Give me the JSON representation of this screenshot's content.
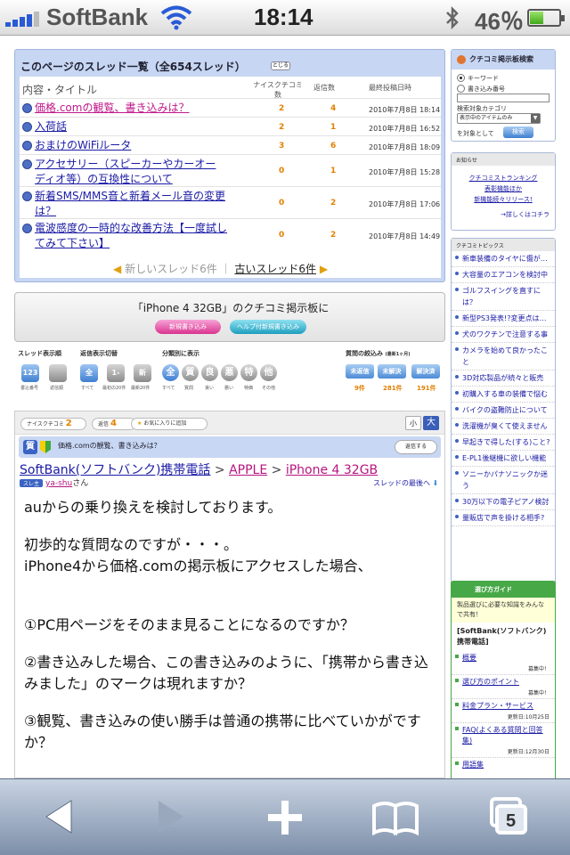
{
  "status": {
    "carrier": "SoftBank",
    "time": "18:14",
    "battery": "46％",
    "battery_level": 0.46
  },
  "thread_list": {
    "heading": "このページのスレッド一覧（全654スレッド）",
    "close_label": "とじる",
    "columns": {
      "title": "内容・タイトル",
      "nice": "ナイスクチコミ数",
      "replies": "返信数",
      "last": "最終投稿日時"
    },
    "rows": [
      {
        "title": "価格.comの観覧、書き込みは？",
        "nice": "2",
        "replies": "4",
        "date": "2010年7月8日 18:14",
        "current": true
      },
      {
        "title": "入荷話",
        "nice": "2",
        "replies": "1",
        "date": "2010年7月8日 16:52"
      },
      {
        "title": "おまけのWiFiルータ",
        "nice": "3",
        "replies": "6",
        "date": "2010年7月8日 18:09"
      },
      {
        "title_lines": [
          "アクセサリー（スピーカーやカーオー",
          "ディオ等）の互換性について"
        ],
        "nice": "0",
        "replies": "1",
        "date": "2010年7月8日 15:28"
      },
      {
        "title_lines": [
          "新着SMS/MMS音と新着メール音の変更",
          "は？"
        ],
        "nice": "0",
        "replies": "2",
        "date": "2010年7月8日 17:06"
      },
      {
        "title_lines": [
          "電波感度の一時的な改善方法【一度試し",
          "てみて下さい】"
        ],
        "nice": "0",
        "replies": "2",
        "date": "2010年7月8日 14:49"
      }
    ],
    "pager": {
      "newer": "新しいスレッド6件",
      "sep": "｜",
      "older": "古いスレッド6件"
    }
  },
  "post_box": {
    "title": "「iPhone 4 32GB」のクチコミ掲示板に",
    "new_post": "新規書き込み",
    "help_post": "ヘルプ付新規書き込み"
  },
  "filters": {
    "display_order": {
      "label": "スレッド表示順",
      "items": [
        {
          "icon": "123",
          "cap": "書込番号"
        },
        {
          "icon": "",
          "cap": "返信順"
        }
      ]
    },
    "display_switch": {
      "label": "返信表示切替",
      "items": [
        {
          "icon": "全",
          "cap": "すべて"
        },
        {
          "icon": "1-20",
          "cap": "最初の20件"
        },
        {
          "icon": "新",
          "cap": "最新20件"
        }
      ]
    },
    "category": {
      "label": "分類別に表示",
      "items": [
        {
          "icon": "全",
          "cap": "すべて"
        },
        {
          "icon": "質",
          "cap": "質問"
        },
        {
          "icon": "良",
          "cap": "良い"
        },
        {
          "icon": "悪",
          "cap": "悪い"
        },
        {
          "icon": "特",
          "cap": "特価"
        },
        {
          "icon": "他",
          "cap": "その他"
        }
      ]
    },
    "question": {
      "label": "質問の絞込み",
      "note": "(最新1ヶ月)",
      "items": [
        {
          "label": "未返信",
          "count": "9件"
        },
        {
          "label": "未解決",
          "count": "281件"
        },
        {
          "label": "解決済",
          "count": "191件"
        }
      ]
    }
  },
  "thread": {
    "nice_label": "ナイスクチコミ",
    "nice_value": "2",
    "reply_label": "返信",
    "reply_value": "4",
    "fav_label": "お気に入りに追加",
    "size_small": "小",
    "size_large": "大",
    "q_icon": "質",
    "q_title": "価格.comの観覧、書き込みは？",
    "reply_btn": "返信する",
    "crumbs": {
      "a": "SoftBank(ソフトバンク)携帯電話",
      "sep1": ">",
      "b": "APPLE",
      "sep2": ">",
      "c": "iPhone 4 32GB"
    },
    "author_tag": "スレ主",
    "author": "ya-shu",
    "author_suffix": "さん",
    "to_bottom": "スレッドの最後へ",
    "body": [
      "auからの乗り換えを検討しております。",
      "初歩的な質問なのですが・・・。",
      "iPhone4から価格.comの掲示板にアクセスした場合、",
      "①PC用ページをそのまま見ることになるのですか？",
      "②書き込みした場合、この書き込みのように、「携帯から書き込みました」のマークは現れますか？",
      "③観覧、書き込みの使い勝手は普通の携帯に比べていかがですか？"
    ]
  },
  "sidebar": {
    "search": {
      "title": "クチコミ掲示板検索",
      "opt1": "キーワード",
      "opt2": "書き込み番号",
      "cat_label": "検索対象カテゴリ",
      "cat_value": "表示中のアイテムのみ",
      "target": "を対象として",
      "btn": "検索"
    },
    "notice": {
      "title": "お知らせ",
      "line1": "クチコミストランキング",
      "line2": "表彰機能ほか",
      "line3": "新機能続々リリース!",
      "more": "→詳しくはコチラ"
    },
    "topics": {
      "title": "クチコミトピックス",
      "items": [
        "新車装備のタイヤに傷が…",
        "大容量のエアコンを検討中",
        "ゴルフスイングを直すには？",
        "新型PS3発表!?変更点は…",
        "犬のワクチンで注意する事",
        "カメラを始めて良かったこと",
        "3D対応製品が続々と販売",
        "初購入する車の装備で悩む",
        "バイクの盗難防止について",
        "洗濯機が臭くて使えません",
        "早起きで得した(する)こと?",
        "E-PL1後継機に欲しい機能",
        "ソニーかパナソニックか迷う",
        "30万以下の電子ピアノ検討",
        "量販店で声を掛ける相手?"
      ]
    },
    "guide": {
      "title": "選び方ガイド",
      "sub": "製品選びに必要な知識をみんなで共有！",
      "product": "[SoftBank(ソフトバンク)携帯電話]",
      "items": [
        {
          "label": "概要",
          "note": "募集中！"
        },
        {
          "label": "選び方のポイント",
          "note": "募集中！"
        },
        {
          "label": "料金プラン・サービス",
          "note": "更新日:10月25日"
        },
        {
          "label": "FAQ(よくある質問と回答集)",
          "note": "更新日:12月30日"
        },
        {
          "label": "用語集",
          "note": ""
        }
      ]
    }
  },
  "toolbar": {
    "tabs_count": "5"
  }
}
